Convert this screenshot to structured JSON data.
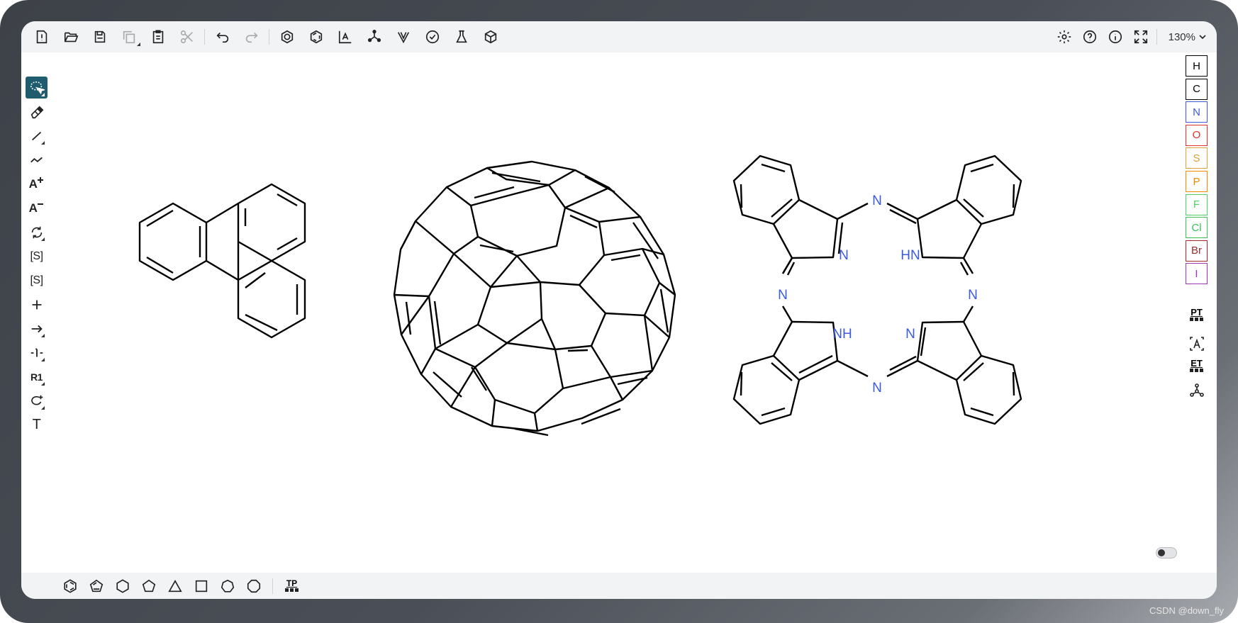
{
  "top_toolbar": {
    "zoom": "130%",
    "left_tools": [
      {
        "name": "new-icon"
      },
      {
        "name": "open-icon"
      },
      {
        "name": "save-icon"
      },
      {
        "name": "copy-icon"
      },
      {
        "name": "paste-icon"
      },
      {
        "name": "cut-icon"
      },
      {
        "name": "undo-icon"
      },
      {
        "name": "redo-icon"
      },
      {
        "name": "aromatize-icon"
      },
      {
        "name": "dearomatize-icon"
      },
      {
        "name": "layout-icon"
      },
      {
        "name": "clean-icon"
      },
      {
        "name": "stereo-icon"
      },
      {
        "name": "check-icon"
      },
      {
        "name": "analyse-icon"
      },
      {
        "name": "3d-view-icon"
      }
    ],
    "right_tools": [
      {
        "name": "settings-icon"
      },
      {
        "name": "help-icon"
      },
      {
        "name": "about-icon"
      },
      {
        "name": "fullscreen-icon"
      }
    ]
  },
  "left_toolbar": {
    "charge_plus": "A",
    "charge_minus": "A",
    "sgroup": "[S]",
    "sgroup_plus": "[S]",
    "rgroup": "R1",
    "text_tool": "T"
  },
  "right_toolbar": {
    "atoms": [
      {
        "symbol": "H",
        "color": "#000000"
      },
      {
        "symbol": "C",
        "color": "#000000"
      },
      {
        "symbol": "N",
        "color": "#3b5bdb"
      },
      {
        "symbol": "O",
        "color": "#e03131"
      },
      {
        "symbol": "S",
        "color": "#d9a23a"
      },
      {
        "symbol": "P",
        "color": "#f08c00"
      },
      {
        "symbol": "F",
        "color": "#51cf66"
      },
      {
        "symbol": "Cl",
        "color": "#40c057"
      },
      {
        "symbol": "Br",
        "color": "#9c2c2c"
      },
      {
        "symbol": "I",
        "color": "#9c36b5"
      }
    ],
    "periodic_table": "PT",
    "extended_table": "ET"
  },
  "bottom_toolbar": {
    "template_library": "TP",
    "templates": [
      {
        "name": "benzene-icon"
      },
      {
        "name": "cyclopentadiene-icon"
      },
      {
        "name": "cyclohexane-icon"
      },
      {
        "name": "cyclopentane-icon"
      },
      {
        "name": "cyclopropane-icon"
      },
      {
        "name": "cyclobutane-icon"
      },
      {
        "name": "cycloheptane-icon"
      },
      {
        "name": "cyclooctane-icon"
      }
    ]
  },
  "canvas": {
    "porphyrin_labels": {
      "n_top": "N",
      "n_left_inner": "N",
      "hn_right_inner": "HN",
      "n_left": "N",
      "n_right": "N",
      "nh_left_inner": "NH",
      "n_right_inner": "N",
      "n_bottom": "N"
    },
    "label_color": "#3b5bdb"
  },
  "watermark": "CSDN @down_fly",
  "colors": {
    "accent": "#1f5d6e",
    "toolbar_bg": "#f1f3f5",
    "frame": "#45494f"
  }
}
